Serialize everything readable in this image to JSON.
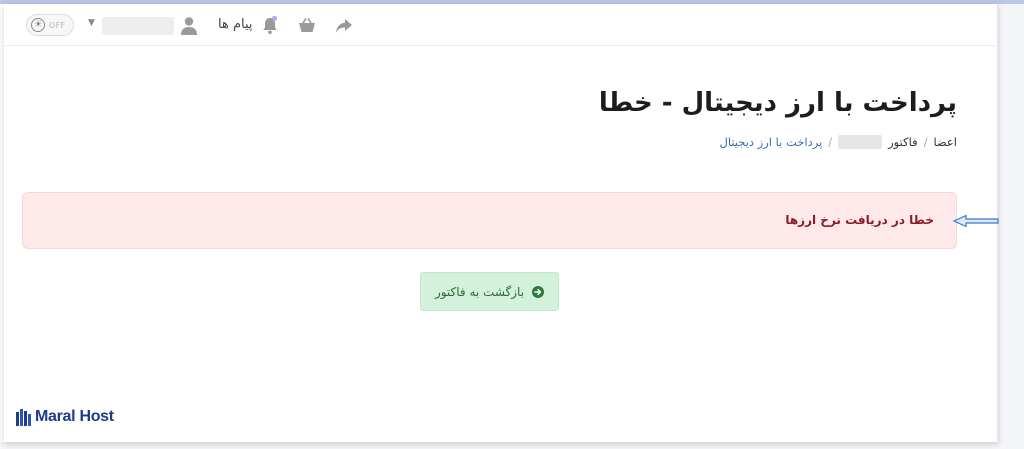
{
  "topbar": {
    "theme_toggle_label": "OFF",
    "messages_label": "پیام ها"
  },
  "page": {
    "title": "پرداخت با ارز دیجیتال - خطا"
  },
  "breadcrumb": {
    "items": [
      "اعضا",
      "فاکتور",
      "پرداخت با ارز دیجیتال"
    ]
  },
  "alert": {
    "message": "خطا در دریافت نرخ ارزها"
  },
  "actions": {
    "back_label": "بازگشت به فاکتور"
  },
  "logo": {
    "text": "Maral Host"
  },
  "colors": {
    "alert_bg": "#fde8ea",
    "alert_text": "#8a1c24",
    "button_bg": "#d3f1db",
    "button_icon": "#2c7a3f",
    "link": "#3b6fb8",
    "logo": "#1f3a8a",
    "annotation_arrow": "#3a78c9"
  }
}
